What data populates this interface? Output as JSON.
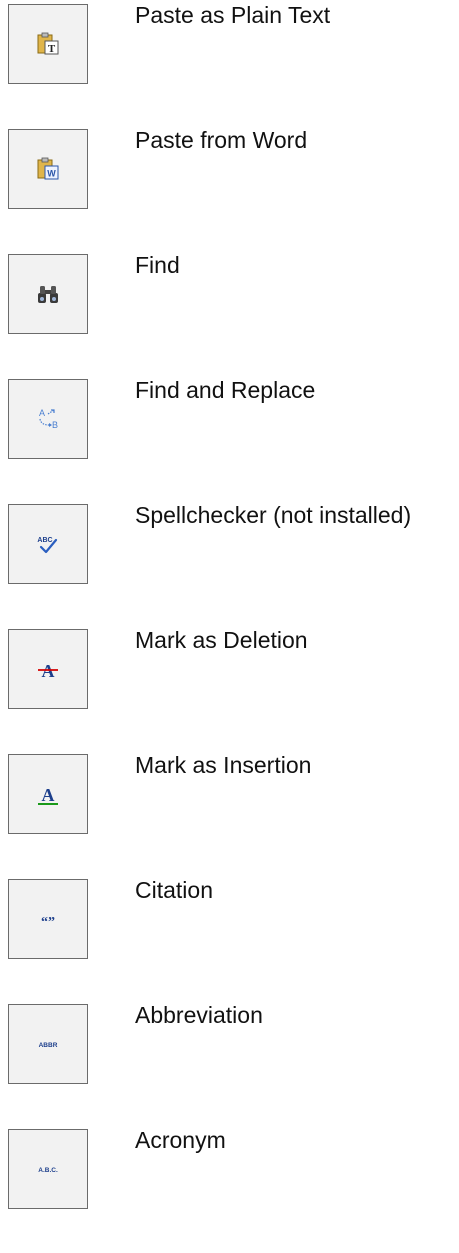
{
  "buttons": [
    {
      "label": "Paste as Plain Text",
      "icon": "paste-plain-text-icon"
    },
    {
      "label": "Paste from Word",
      "icon": "paste-from-word-icon"
    },
    {
      "label": "Find",
      "icon": "binoculars-icon"
    },
    {
      "label": "Find and Replace",
      "icon": "find-replace-icon"
    },
    {
      "label": "Spellchecker (not installed)",
      "icon": "spellcheck-icon"
    },
    {
      "label": "Mark as Deletion",
      "icon": "strikethrough-a-icon"
    },
    {
      "label": "Mark as Insertion",
      "icon": "underline-a-icon"
    },
    {
      "label": "Citation",
      "icon": "quotes-icon"
    },
    {
      "label": "Abbreviation",
      "icon": "abbr-icon"
    },
    {
      "label": "Acronym",
      "icon": "acronym-icon"
    }
  ],
  "icon_text": {
    "word_letter": "W",
    "text_letter": "T",
    "find_a": "A",
    "find_b": "B",
    "abc": "ABC",
    "letter_a": "A",
    "quotes": "“”",
    "abbr": "ABBR",
    "acronym": "A.B.C."
  },
  "colors": {
    "deletion_line": "#d40000",
    "insertion_line": "#1a9a1a",
    "icon_blue": "#1d3f8c",
    "find_replace_blue": "#4a7fd0"
  }
}
